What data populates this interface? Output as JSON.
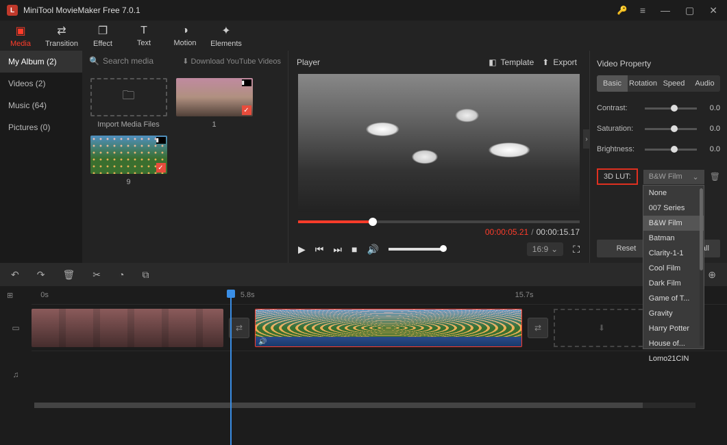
{
  "titlebar": {
    "title": "MiniTool MovieMaker Free 7.0.1"
  },
  "tools": {
    "media": "Media",
    "transition": "Transition",
    "effect": "Effect",
    "text": "Text",
    "motion": "Motion",
    "elements": "Elements"
  },
  "sidebar": {
    "album": "My Album (2)",
    "videos": "Videos (2)",
    "music": "Music (64)",
    "pictures": "Pictures (0)"
  },
  "media": {
    "search_ph": "Search media",
    "download": "Download YouTube Videos",
    "import": "Import Media Files",
    "thumb1": "1",
    "thumb2": "9"
  },
  "player": {
    "title": "Player",
    "template": "Template",
    "export": "Export",
    "current": "00:00:05.21",
    "sep": "/",
    "duration": "00:00:15.17",
    "aspect": "16:9"
  },
  "prop": {
    "title": "Video Property",
    "tabs": {
      "basic": "Basic",
      "rotation": "Rotation",
      "speed": "Speed",
      "audio": "Audio"
    },
    "contrast": "Contrast:",
    "contrast_v": "0.0",
    "saturation": "Saturation:",
    "saturation_v": "0.0",
    "brightness": "Brightness:",
    "brightness_v": "0.0",
    "lut": "3D LUT:",
    "lut_value": "B&W Film",
    "reset": "Reset",
    "apply": "Apply to all",
    "options": [
      "None",
      "007 Series",
      "B&W Film",
      "Batman",
      "Clarity-1-1",
      "Cool Film",
      "Dark Film",
      "Game of T...",
      "Gravity",
      "Harry Potter",
      "House of...",
      "Lomo21CIN"
    ]
  },
  "timeline": {
    "t0": "0s",
    "t1": "5.8s",
    "t2": "15.7s"
  }
}
